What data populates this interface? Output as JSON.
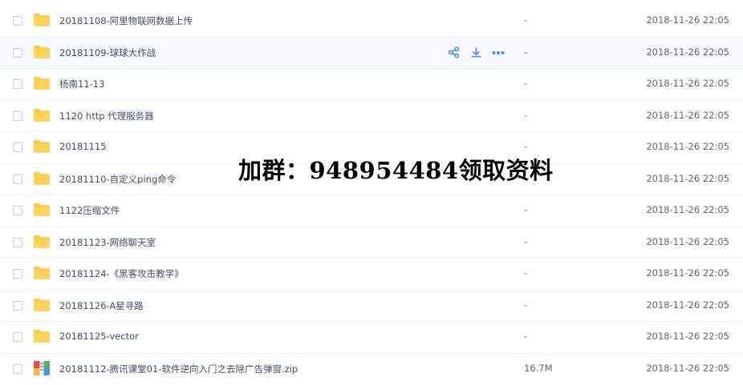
{
  "files": [
    {
      "name": "20181108-阿里物联网数据上传",
      "size": "-",
      "date": "2018-11-26 22:05",
      "icon": "folder-icon"
    },
    {
      "name": "20181109-球球大作战",
      "size": "-",
      "date": "2018-11-26 22:05",
      "icon": "folder-icon",
      "hovered": true
    },
    {
      "name": "杨南11-13",
      "size": "-",
      "date": "2018-11-26 22:05",
      "icon": "folder-icon"
    },
    {
      "name": "1120 http 代理服务器",
      "size": "-",
      "date": "2018-11-26 22:05",
      "icon": "folder-icon"
    },
    {
      "name": "20181115",
      "size": "-",
      "date": "2018-11-26 22:05",
      "icon": "folder-icon"
    },
    {
      "name": "20181110-自定义ping命令",
      "size": "-",
      "date": "2018-11-26 22:05",
      "icon": "folder-icon"
    },
    {
      "name": "1122压缩文件",
      "size": "-",
      "date": "2018-11-26 22:05",
      "icon": "folder-icon"
    },
    {
      "name": "20181123-网络聊天室",
      "size": "-",
      "date": "2018-11-26 22:05",
      "icon": "folder-icon"
    },
    {
      "name": "20181124-《黑客攻击教学》",
      "size": "-",
      "date": "2018-11-26 22:05",
      "icon": "folder-icon"
    },
    {
      "name": "20181126-A星寻路",
      "size": "-",
      "date": "2018-11-26 22:05",
      "icon": "folder-icon"
    },
    {
      "name": "20181125-vector",
      "size": "-",
      "date": "2018-11-26 22:05",
      "icon": "folder-icon"
    },
    {
      "name": "20181112-腾讯课堂01-软件逆向入门之去除广告弹窗.zip",
      "size": "16.7M",
      "date": "2018-11-26 22:05",
      "icon": "zip-archive-icon"
    }
  ],
  "row_actions": [
    "share-icon",
    "download-icon",
    "more-icon"
  ],
  "overlay_text": "加群：948954484领取资料",
  "colors": {
    "folder": "#ffc845",
    "accent": "#3b8cff",
    "hover_bg": "#f6f9fe"
  }
}
